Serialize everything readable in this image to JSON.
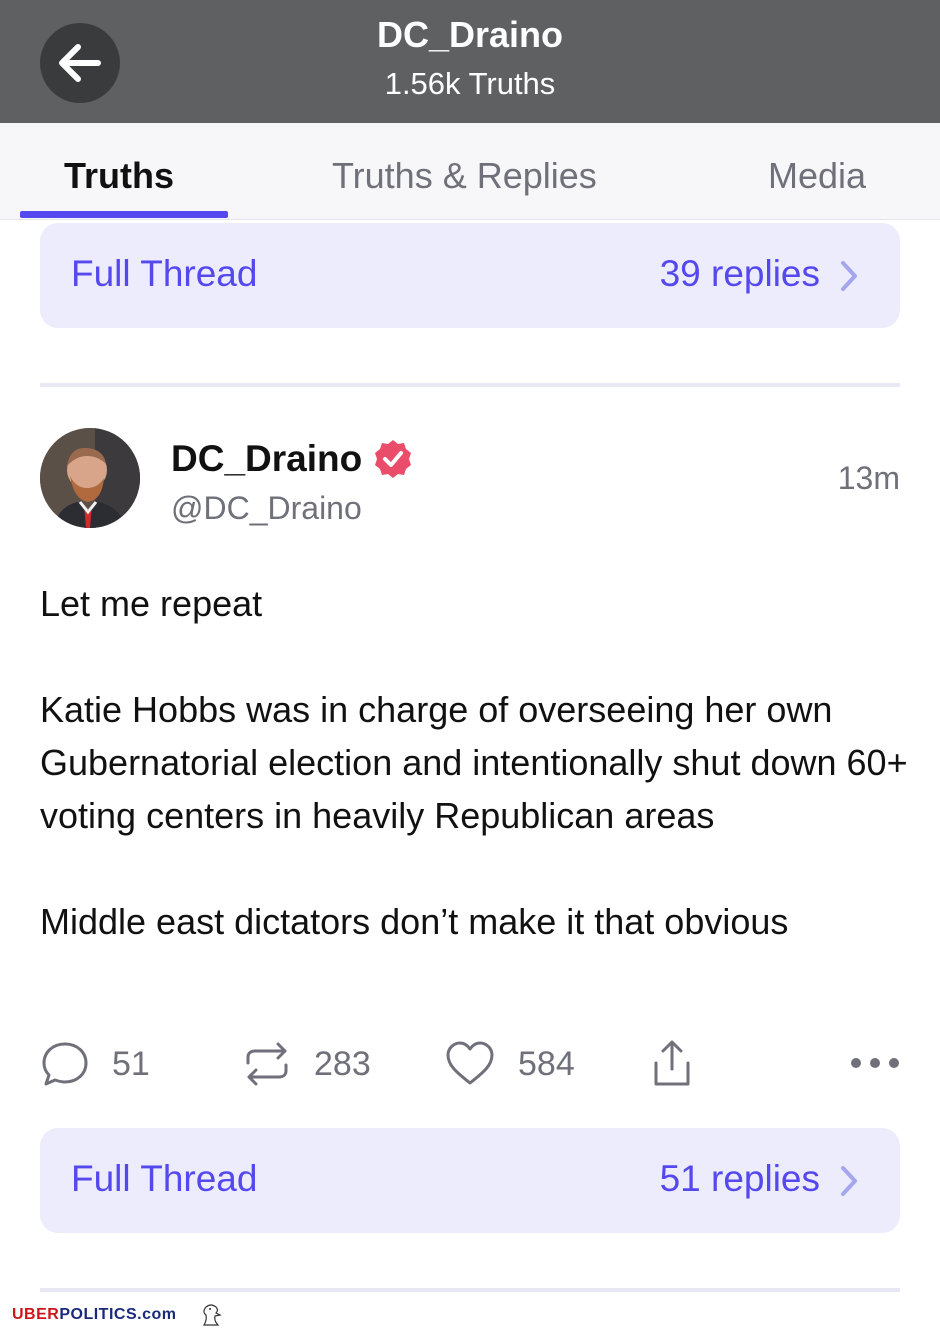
{
  "header": {
    "title": "DC_Draino",
    "subtitle": "1.56k Truths"
  },
  "tabs": [
    {
      "label": "Truths",
      "active": true
    },
    {
      "label": "Truths & Replies",
      "active": false
    },
    {
      "label": "Media",
      "active": false
    }
  ],
  "thread_top": {
    "label": "Full Thread",
    "count": "39 replies"
  },
  "post": {
    "author_name": "DC_Draino",
    "handle": "@DC_Draino",
    "time": "13m",
    "verified": true,
    "paragraphs": [
      "Let me repeat",
      "Katie Hobbs was in charge of overseeing her own Gubernatorial election and intentionally shut down 60+ voting centers in heavily Republican areas",
      "Middle east dictators don’t make it that obvious"
    ],
    "actions": {
      "replies": "51",
      "retruths": "283",
      "likes": "584"
    }
  },
  "thread_bottom": {
    "label": "Full Thread",
    "count": "51 replies"
  },
  "footer": {
    "brand_red": "UBER",
    "brand_blue": "POLITICS.com"
  },
  "colors": {
    "accent": "#5448ee",
    "verified": "#e94d6a",
    "header_bg": "#5f6062",
    "thread_bg": "#ececfd"
  }
}
